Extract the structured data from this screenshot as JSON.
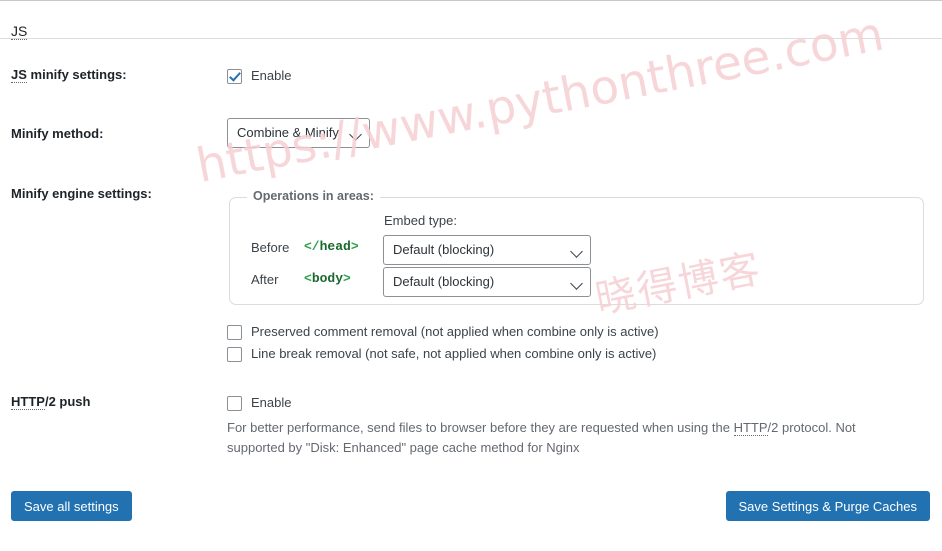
{
  "page": {
    "section_heading": "JS",
    "section_heading_abbr": "JS"
  },
  "rows": {
    "js_minify": {
      "label_abbr": "JS",
      "label_rest": " minify settings:",
      "enable_label": "Enable",
      "enable_checked": true
    },
    "minify_method": {
      "label": "Minify method:",
      "selected": "Combine & Minify"
    },
    "minify_engine": {
      "label": "Minify engine settings:",
      "legend": "Operations in areas:",
      "embed_type_label": "Embed type:",
      "areas": [
        {
          "when": "Before",
          "tag_open": "</",
          "tag_name": "head",
          "tag_close": ">",
          "embed_type": "Default (blocking)"
        },
        {
          "when": "After",
          "tag_open": "<",
          "tag_name": "body",
          "tag_close": ">",
          "embed_type": "Default (blocking)"
        }
      ],
      "options": [
        {
          "label": "Preserved comment removal (not applied when combine only is active)",
          "checked": false
        },
        {
          "label": "Line break removal (not safe, not applied when combine only is active)",
          "checked": false
        }
      ]
    },
    "http2_push": {
      "label_abbr": "HTTP",
      "label_rest": "/2 push",
      "enable_label": "Enable",
      "enable_checked": false,
      "description_part1": "For better performance, send files to browser before they are requested when using the ",
      "description_abbr": "HTTP",
      "description_part2": "/2 protocol. Not supported by \"Disk: Enhanced\" page cache method for Nginx"
    }
  },
  "footer": {
    "save_all_label": "Save all settings",
    "save_purge_label": "Save Settings & Purge Caches"
  },
  "watermark": {
    "url": "https://www.pythonthree.com",
    "cn": "晓得博客"
  },
  "colors": {
    "accent": "#2271b1",
    "code_green": "#19692c",
    "bracket_green": "#2e9e4f",
    "divider": "#dcdcde",
    "muted_text": "#646970",
    "watermark": "#f6cfd3"
  }
}
